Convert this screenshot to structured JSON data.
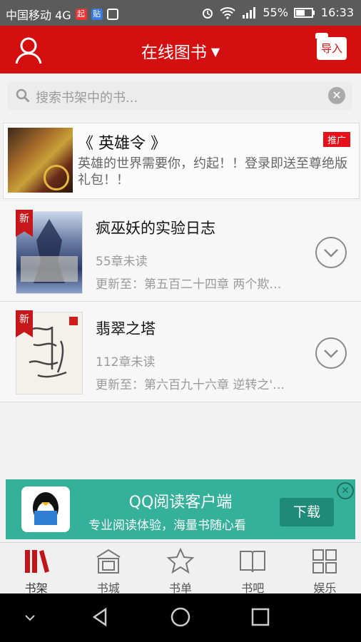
{
  "status_bar": {
    "carrier": "中国移动 4G",
    "icon_a": "起",
    "icon_b": "贴",
    "battery": "55%",
    "time": "16:33"
  },
  "header": {
    "title": "在线图书",
    "import_label": "导入"
  },
  "search": {
    "placeholder": "搜索书架中的书..."
  },
  "ad": {
    "title": "《 英雄令 》",
    "tag": "推广",
    "description": "英雄的世界需要你，约起！！登录即送至尊绝版礼包！！"
  },
  "books": [
    {
      "new_tag": "新",
      "title": "疯巫妖的实验日志",
      "unread": "55章未读",
      "update": "更新至：第五百二十四章 两个欺…"
    },
    {
      "new_tag": "新",
      "title": "翡翠之塔",
      "unread": "112章未读",
      "update": "更新至：第六百九十六章 逆转之'…"
    }
  ],
  "promo": {
    "title": "QQ阅读客户端",
    "subtitle": "专业阅读体验，海量书随心看",
    "button": "下载"
  },
  "tabs": [
    {
      "label": "书架",
      "icon": "bookshelf-icon"
    },
    {
      "label": "书城",
      "icon": "bookstore-icon"
    },
    {
      "label": "书单",
      "icon": "star-icon"
    },
    {
      "label": "书吧",
      "icon": "open-book-icon"
    },
    {
      "label": "娱乐",
      "icon": "grid-icon"
    }
  ],
  "colors": {
    "brand": "#d30f10",
    "promo": "#35b09a"
  }
}
